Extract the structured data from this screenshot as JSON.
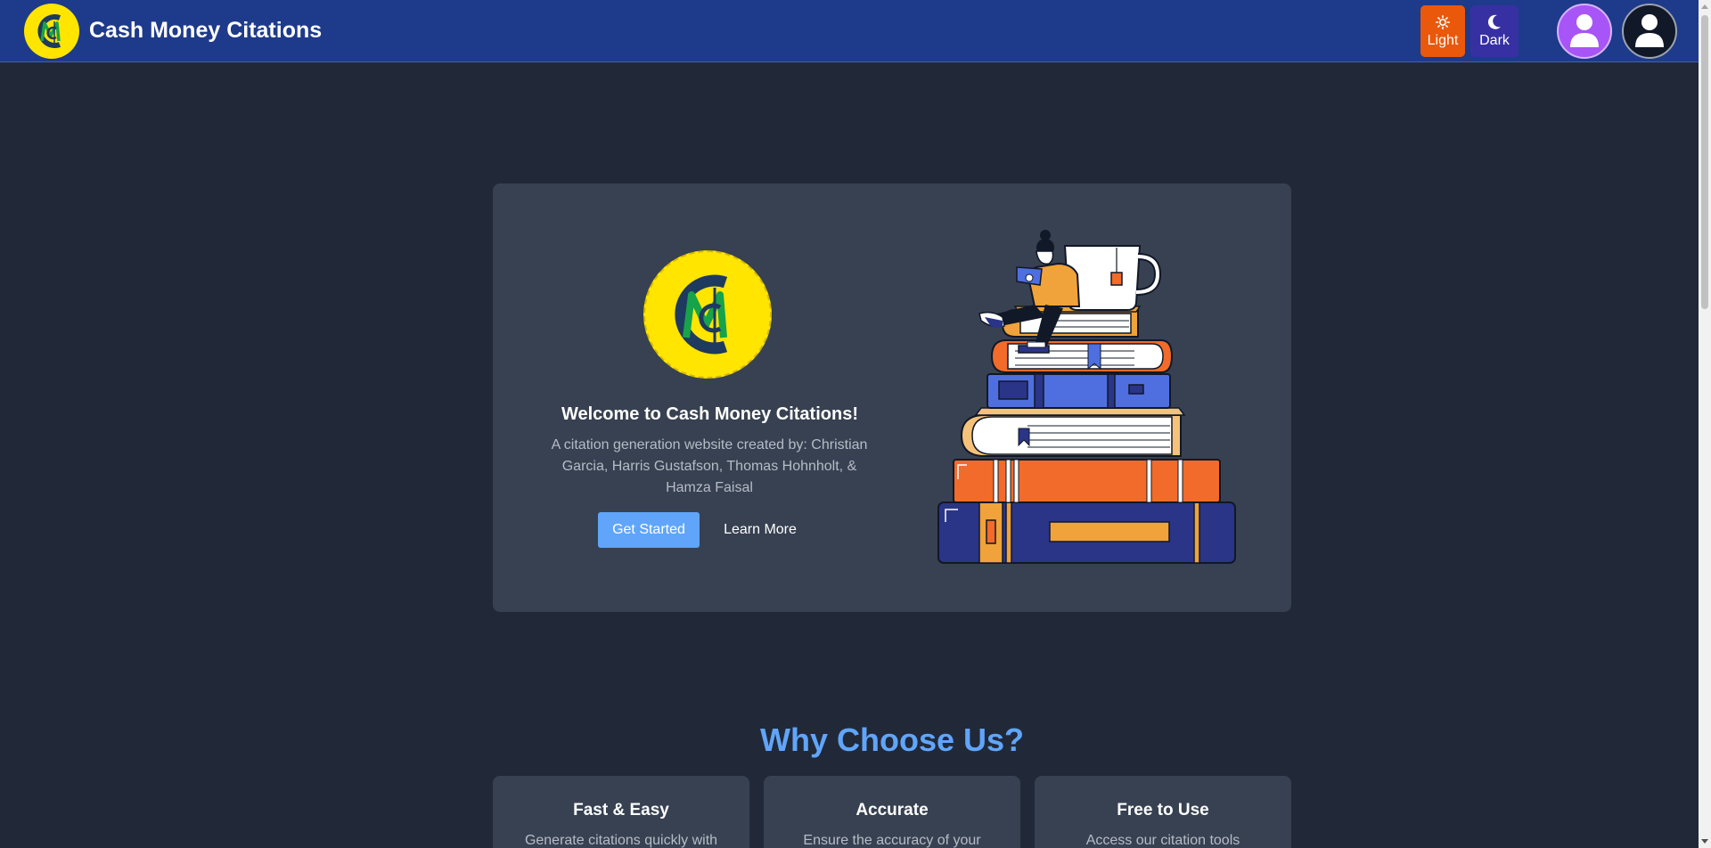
{
  "header": {
    "brand_title": "Cash Money Citations",
    "logo_text": "MC",
    "theme": {
      "light_label": "Light",
      "dark_label": "Dark",
      "light_icon": "sun-icon",
      "dark_icon": "moon-icon"
    },
    "avatars": [
      "user-avatar-icon",
      "user-avatar-icon"
    ]
  },
  "hero": {
    "title": "Welcome to Cash Money Citations!",
    "description": "A citation generation website created by: Christian Garcia, Harris Gustafson, Thomas Hohnholt, & Hamza Faisal",
    "primary_button": "Get Started",
    "secondary_button": "Learn More",
    "illustration": "person-reading-on-books-illustration"
  },
  "why": {
    "title": "Why Choose Us?",
    "features": [
      {
        "title": "Fast & Easy",
        "text": "Generate citations quickly with"
      },
      {
        "title": "Accurate",
        "text": "Ensure the accuracy of your"
      },
      {
        "title": "Free to Use",
        "text": "Access our citation tools"
      }
    ]
  },
  "colors": {
    "header_bg": "#1e3a8a",
    "page_bg": "#212938",
    "card_bg": "#374151",
    "accent_blue": "#60a5fa",
    "light_btn": "#ea580c",
    "dark_btn": "#3730a3",
    "logo_yellow": "#ffe500"
  }
}
